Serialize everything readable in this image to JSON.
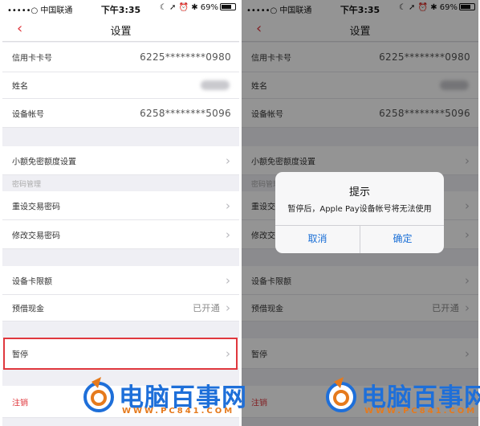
{
  "status_bar": {
    "carrier": "•••••○ 中国联通",
    "time": "下午3:35",
    "battery": "69%"
  },
  "nav": {
    "back": "‹",
    "title": "设置"
  },
  "rows": {
    "credit_card": {
      "label": "信用卡卡号",
      "value": "6225********0980"
    },
    "name": {
      "label": "姓名"
    },
    "device_account": {
      "label": "设备帐号",
      "value": "6258********5096"
    },
    "small_amount": {
      "label": "小额免密额度设置"
    },
    "password_section": "密码管理",
    "reset_password": {
      "label": "重设交易密码"
    },
    "change_password": {
      "label": "修改交易密码"
    },
    "card_limit": {
      "label": "设备卡限额"
    },
    "cash_advance": {
      "label": "预借现金",
      "status": "已开通"
    },
    "pause": {
      "label": "暂停"
    },
    "cancel_account": {
      "label": "注销"
    }
  },
  "alert": {
    "title": "提示",
    "message": "暂停后，Apple Pay设备帐号将无法使用",
    "cancel": "取消",
    "confirm": "确定"
  },
  "watermark": {
    "brand": "电脑百事网",
    "url": "WWW.PC841.COM"
  },
  "colors": {
    "accent_red": "#e0383e",
    "button_blue": "#1a6fd6",
    "watermark_blue": "#1e6fd9",
    "watermark_orange": "#e57a1d"
  }
}
